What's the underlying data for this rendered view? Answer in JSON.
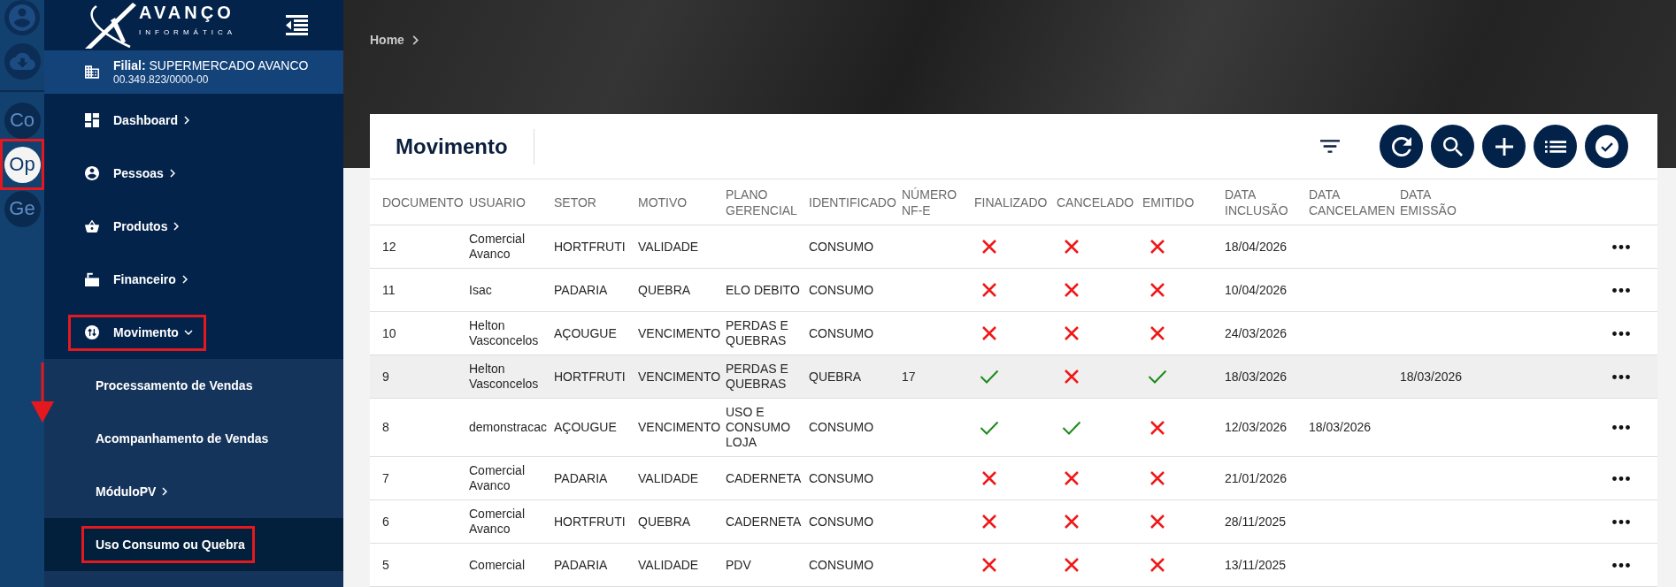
{
  "rail": {
    "items": [
      {
        "label": "Co",
        "selected": false,
        "highlighted": false
      },
      {
        "label": "Op",
        "selected": true,
        "highlighted": true
      },
      {
        "label": "Ge",
        "selected": false,
        "highlighted": false
      }
    ]
  },
  "sidebar": {
    "logo": {
      "name": "AVANÇO",
      "tagline": "INFORMÁTICA"
    },
    "branch": {
      "label": "**Filial:** SUPERMERCADO AVANCO",
      "cnpj": "00.349.823/0000-00"
    },
    "menu": [
      {
        "label": "Dashboard",
        "expanded": false,
        "highlighted": false
      },
      {
        "label": "Pessoas",
        "expanded": false,
        "highlighted": false
      },
      {
        "label": "Produtos",
        "expanded": false,
        "highlighted": false
      },
      {
        "label": "Financeiro",
        "expanded": false,
        "highlighted": false
      },
      {
        "label": "Movimento",
        "expanded": true,
        "highlighted": true,
        "children": [
          {
            "label": "Processamento de Vendas",
            "kind": "link",
            "selected": false,
            "highlighted": false
          },
          {
            "label": "Acompanhamento de Vendas",
            "kind": "link",
            "selected": false,
            "highlighted": false
          },
          {
            "label": "MóduloPV",
            "kind": "group",
            "selected": false,
            "highlighted": false
          },
          {
            "label": "Uso Consumo ou Quebra",
            "kind": "link",
            "selected": true,
            "highlighted": true
          }
        ]
      }
    ]
  },
  "breadcrumb": [
    {
      "label": "Home"
    }
  ],
  "page": {
    "title": "Movimento"
  },
  "table": {
    "columns": [
      {
        "label": "DOCUMENTO",
        "kind": "text"
      },
      {
        "label": "USUARIO",
        "kind": "text"
      },
      {
        "label": "SETOR",
        "kind": "text"
      },
      {
        "label": "MOTIVO",
        "kind": "text"
      },
      {
        "label": "PLANO GERENCIAL",
        "kind": "text"
      },
      {
        "label": "IDENTIFICADO",
        "kind": "text"
      },
      {
        "label": "NÚMERO NF-E",
        "kind": "text"
      },
      {
        "label": "FINALIZADO",
        "kind": "flag"
      },
      {
        "label": "CANCELADO",
        "kind": "flag"
      },
      {
        "label": "EMITIDO",
        "kind": "flag"
      },
      {
        "label": "DATA INCLUSÃO",
        "kind": "text"
      },
      {
        "label": "DATA CANCELAMEN",
        "kind": "text"
      },
      {
        "label": "DATA EMISSÃO",
        "kind": "text"
      }
    ],
    "rows": [
      {
        "highlighted": false,
        "cells": [
          "12",
          "Comercial Avanco",
          "HORTFRUTI",
          "VALIDADE",
          null,
          "CONSUMO",
          null,
          false,
          false,
          false,
          "18/04/2026",
          null,
          null
        ]
      },
      {
        "highlighted": false,
        "cells": [
          "11",
          "Isac",
          "PADARIA",
          "QUEBRA",
          "ELO DEBITO",
          "CONSUMO",
          null,
          false,
          false,
          false,
          "10/04/2026",
          null,
          null
        ]
      },
      {
        "highlighted": false,
        "cells": [
          "10",
          "Helton Vasconcelos",
          "AÇOUGUE",
          "VENCIMENTO",
          "PERDAS E QUEBRAS",
          "CONSUMO",
          null,
          false,
          false,
          false,
          "24/03/2026",
          null,
          null
        ]
      },
      {
        "highlighted": true,
        "cells": [
          "9",
          "Helton Vasconcelos",
          "HORTFRUTI",
          "VENCIMENTO",
          "PERDAS E QUEBRAS",
          "QUEBRA",
          "17",
          true,
          false,
          true,
          "18/03/2026",
          null,
          "18/03/2026"
        ]
      },
      {
        "highlighted": false,
        "cells": [
          "8",
          "demonstracac",
          "AÇOUGUE",
          "VENCIMENTO",
          "USO E CONSUMO LOJA",
          "CONSUMO",
          null,
          true,
          true,
          false,
          "12/03/2026",
          "18/03/2026",
          null
        ]
      },
      {
        "highlighted": false,
        "cells": [
          "7",
          "Comercial Avanco",
          "PADARIA",
          "VALIDADE",
          "CADERNETA",
          "CONSUMO",
          null,
          false,
          false,
          false,
          "21/01/2026",
          null,
          null
        ]
      },
      {
        "highlighted": false,
        "cells": [
          "6",
          "Comercial Avanco",
          "HORTFRUTI",
          "QUEBRA",
          "CADERNETA",
          "CONSUMO",
          null,
          false,
          false,
          false,
          "28/11/2025",
          null,
          null
        ]
      },
      {
        "highlighted": false,
        "cells": [
          "5",
          "Comercial",
          "PADARIA",
          "VALIDADE",
          "PDV",
          "CONSUMO",
          null,
          false,
          false,
          false,
          "13/11/2025",
          null,
          null
        ]
      }
    ]
  }
}
